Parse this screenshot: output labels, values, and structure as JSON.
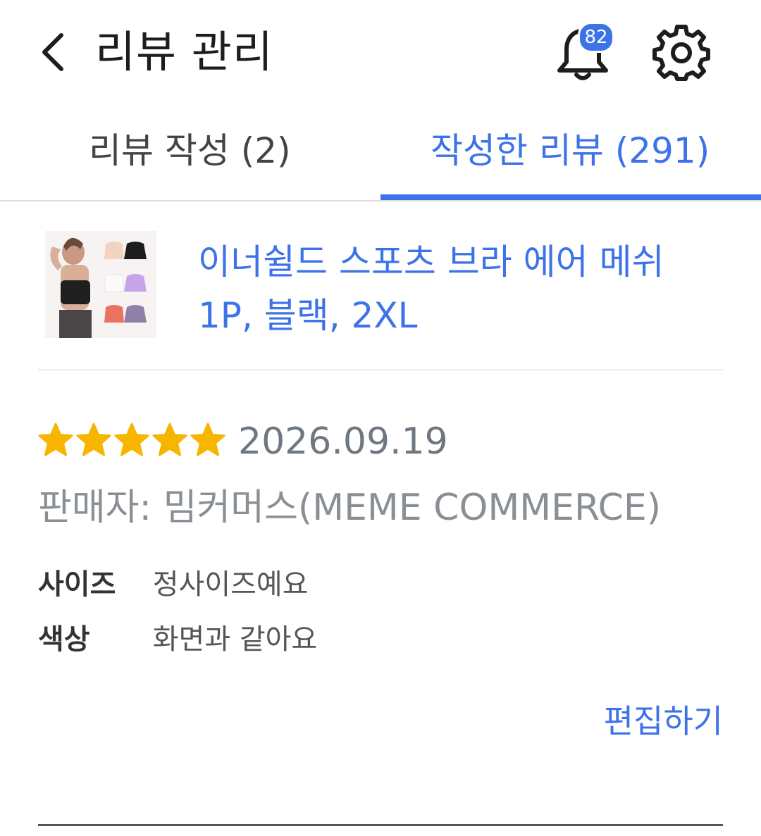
{
  "header": {
    "title": "리뷰 관리",
    "notification_count": "82",
    "icons": [
      "back-arrow-icon",
      "bell-icon",
      "gear-icon"
    ]
  },
  "tabs": [
    {
      "label": "리뷰 작성 (2)",
      "active": false
    },
    {
      "label": "작성한 리뷰 (291)",
      "active": true
    }
  ],
  "product": {
    "title": "이너쉴드 스포츠 브라 에어 메쉬 1P, 블랙, 2XL"
  },
  "review": {
    "rating": 5,
    "rating_max": 5,
    "date": "2026.09.19",
    "seller": "판매자: 밈커머스(MEME COMMERCE)",
    "attributes": [
      {
        "key": "사이즈",
        "value": "정사이즈예요"
      },
      {
        "key": "색상",
        "value": "화면과 같아요"
      }
    ],
    "edit_label": "편집하기"
  },
  "colors": {
    "accent": "#3d73e8",
    "star": "#f7b500",
    "badge": "#3d73e8"
  }
}
